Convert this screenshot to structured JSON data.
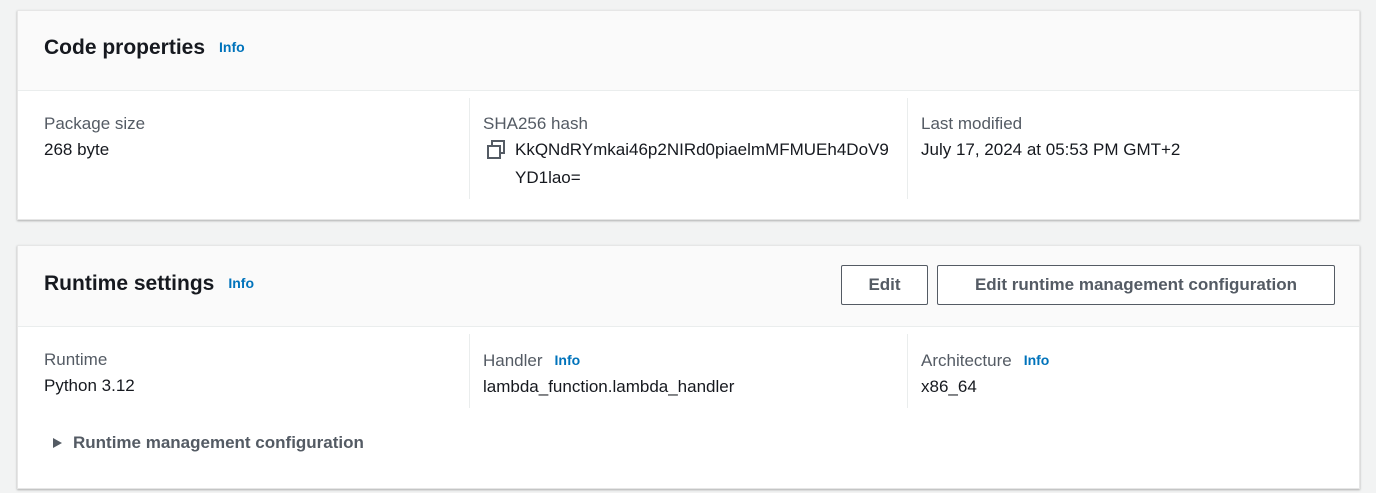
{
  "code_properties": {
    "title": "Code properties",
    "info_label": "Info",
    "package_size": {
      "label": "Package size",
      "value": "268 byte"
    },
    "sha256": {
      "label": "SHA256 hash",
      "value": "KkQNdRYmkai46p2NIRd0piaelmMFMUEh4DoV9YD1lao=",
      "icon": "copy-icon"
    },
    "last_modified": {
      "label": "Last modified",
      "value": "July 17, 2024 at 05:53 PM GMT+2"
    }
  },
  "runtime_settings": {
    "title": "Runtime settings",
    "info_label": "Info",
    "edit_button": "Edit",
    "edit_runtime_button": "Edit runtime management configuration",
    "runtime": {
      "label": "Runtime",
      "value": "Python 3.12"
    },
    "handler": {
      "label": "Handler",
      "info_label": "Info",
      "value": "lambda_function.lambda_handler"
    },
    "architecture": {
      "label": "Architecture",
      "info_label": "Info",
      "value": "x86_64"
    },
    "expander": {
      "label": "Runtime management configuration",
      "icon": "caret-right-icon"
    }
  },
  "colors": {
    "page_bg": "#f2f3f3",
    "link": "#0073bb",
    "text": "#16191f",
    "label": "#545b64"
  }
}
